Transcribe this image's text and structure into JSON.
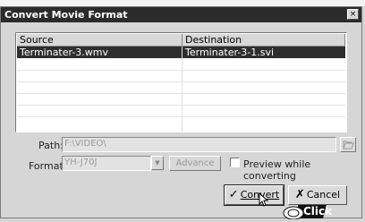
{
  "window": {
    "title": "Convert Movie Format",
    "close_label": "×"
  },
  "file_list": {
    "columns": [
      "Source",
      "Destination"
    ],
    "rows": [
      {
        "source": "Terminater-3.wmv",
        "destination": "Terminater-3-1.svi",
        "selected": true
      }
    ]
  },
  "path": {
    "label": "Path:",
    "value": "F:\\VIDEO\\",
    "browse_icon": "folder-icon"
  },
  "format": {
    "label": "Format:",
    "value": "YH-J70J",
    "advance_label": "Advance"
  },
  "preview": {
    "label": "Preview while converting",
    "checked": false
  },
  "buttons": {
    "convert_label": "Convert",
    "convert_icon": "checkmark-icon",
    "cancel_label": "Cancel",
    "cancel_icon": "x-icon"
  },
  "overlay": {
    "click_label": "Click"
  },
  "colors": {
    "titlebar": "#2b2b2b",
    "selected_row": "#2e2e2e",
    "dialog_bg": "#d6d6d6"
  }
}
